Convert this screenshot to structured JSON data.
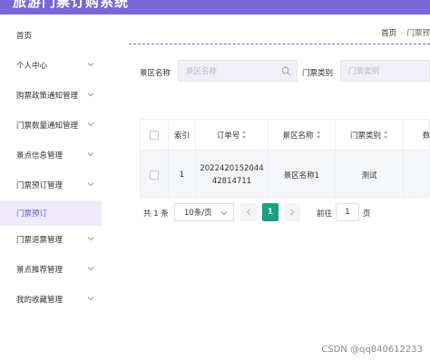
{
  "app": {
    "title": "旅游门票订购系统"
  },
  "sidebar": {
    "items": [
      {
        "label": "首页",
        "has_submenu": false,
        "active": false
      },
      {
        "label": "个人中心",
        "has_submenu": true,
        "active": false
      },
      {
        "label": "购票政策通知管理",
        "has_submenu": true,
        "active": false
      },
      {
        "label": "门票数量通知管理",
        "has_submenu": true,
        "active": false
      },
      {
        "label": "景点信息管理",
        "has_submenu": true,
        "active": false
      },
      {
        "label": "门票预订管理",
        "has_submenu": true,
        "active": false
      },
      {
        "label": "门票预订",
        "has_submenu": false,
        "active": true
      },
      {
        "label": "门票退票管理",
        "has_submenu": true,
        "active": false
      },
      {
        "label": "景点推荐管理",
        "has_submenu": true,
        "active": false
      },
      {
        "label": "我的收藏管理",
        "has_submenu": true,
        "active": false
      }
    ]
  },
  "breadcrumb": {
    "home": "首页",
    "current": "门票预"
  },
  "filters": {
    "scenic_name": {
      "label": "景区名称",
      "placeholder": "景区名称"
    },
    "ticket_type": {
      "label": "门票类别",
      "placeholder": "门票类别"
    }
  },
  "table": {
    "headers": {
      "index": "索引",
      "order_no": "订单号",
      "scenic_name": "景区名称",
      "ticket_type": "门票类别",
      "count": "数"
    },
    "rows": [
      {
        "index": "1",
        "order_no_line1": "2022420152044",
        "order_no_line2": "42814711",
        "scenic_name": "景区名称1",
        "ticket_type": "测试"
      }
    ]
  },
  "pagination": {
    "total": "共 1 条",
    "page_size": "10条/页",
    "current_page": "1",
    "goto_label": "前往",
    "goto_value": "1",
    "goto_suffix": "页"
  },
  "watermark": "CSDN @qq840612233",
  "colors": {
    "brand": "#7a66d8",
    "active_page": "#17a086",
    "active_menu_bg": "#efebfb"
  }
}
